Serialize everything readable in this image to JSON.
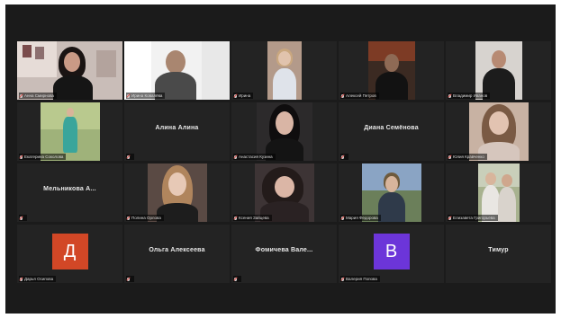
{
  "meeting": {
    "active_color": "#b5cf3c",
    "background": "#1b1b1b",
    "tile_background": "#232323"
  },
  "participants": [
    {
      "label": "Анна Смирнова",
      "type": "video",
      "active": true
    },
    {
      "label": "Ирина Ковалёва",
      "type": "video"
    },
    {
      "label": "Ирина",
      "type": "video"
    },
    {
      "label": "Алексей Петров",
      "type": "video"
    },
    {
      "label": "Владимир Иванов",
      "type": "video"
    },
    {
      "label": "Екатерина Соколова",
      "type": "video"
    },
    {
      "label": "",
      "type": "name",
      "display_name": "Алина Алина"
    },
    {
      "label": "Анастасия Кузина",
      "type": "video"
    },
    {
      "label": "",
      "type": "name",
      "display_name": "Диана Семёнова"
    },
    {
      "label": "Юлия Кравченко",
      "type": "video"
    },
    {
      "label": "",
      "type": "name",
      "display_name": "Мельникова А..."
    },
    {
      "label": "Полина Орлова",
      "type": "video"
    },
    {
      "label": "Ксения Зайцева",
      "type": "video"
    },
    {
      "label": "Мария Федорова",
      "type": "video"
    },
    {
      "label": "Елизавета Григорьева",
      "type": "video"
    },
    {
      "label": "Дарья Осипова",
      "type": "avatar",
      "avatar_letter": "Д",
      "avatar_color": "#d24726"
    },
    {
      "label": "",
      "type": "name",
      "display_name": "Ольга Алексеева"
    },
    {
      "label": "",
      "type": "name",
      "display_name": "Фомичева Вале..."
    },
    {
      "label": "Валерия Попова",
      "type": "avatar",
      "avatar_letter": "В",
      "avatar_color": "#6c35d9"
    },
    {
      "label": "",
      "type": "name",
      "display_name": "Тимур"
    }
  ]
}
